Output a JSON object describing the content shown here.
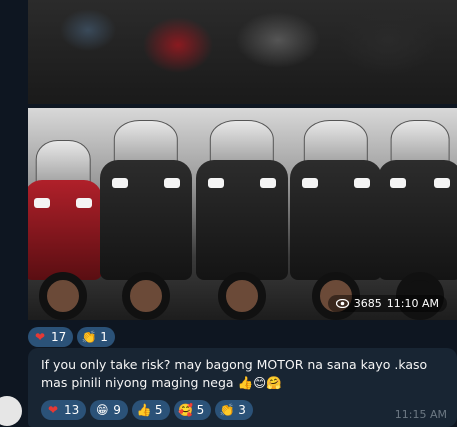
{
  "photo_post": {
    "views": "3685",
    "time": "11:10 AM",
    "reactions": [
      {
        "icon": "heart-icon",
        "glyph": "❤",
        "count": "17"
      },
      {
        "icon": "clapping-hands-icon",
        "glyph": "👏",
        "count": "1"
      }
    ]
  },
  "text_post": {
    "message": "If you only take risk? may bagong MOTOR na sana kayo .kaso mas pinili niyong maging nega 👍😊🤗",
    "time": "11:15 AM",
    "reactions": [
      {
        "icon": "heart-icon",
        "glyph": "❤",
        "count": "13"
      },
      {
        "icon": "grinning-face-icon",
        "glyph": "😁",
        "count": "9"
      },
      {
        "icon": "thumbs-up-icon",
        "glyph": "👍",
        "count": "5"
      },
      {
        "icon": "smiling-face-with-hearts-icon",
        "glyph": "🥰",
        "count": "5"
      },
      {
        "icon": "clapping-hands-icon",
        "glyph": "👏",
        "count": "3"
      }
    ]
  },
  "colors": {
    "background": "#0e1621",
    "bubble": "#182533",
    "reaction_chip": "#2b5278",
    "time_text": "#6c7883"
  }
}
